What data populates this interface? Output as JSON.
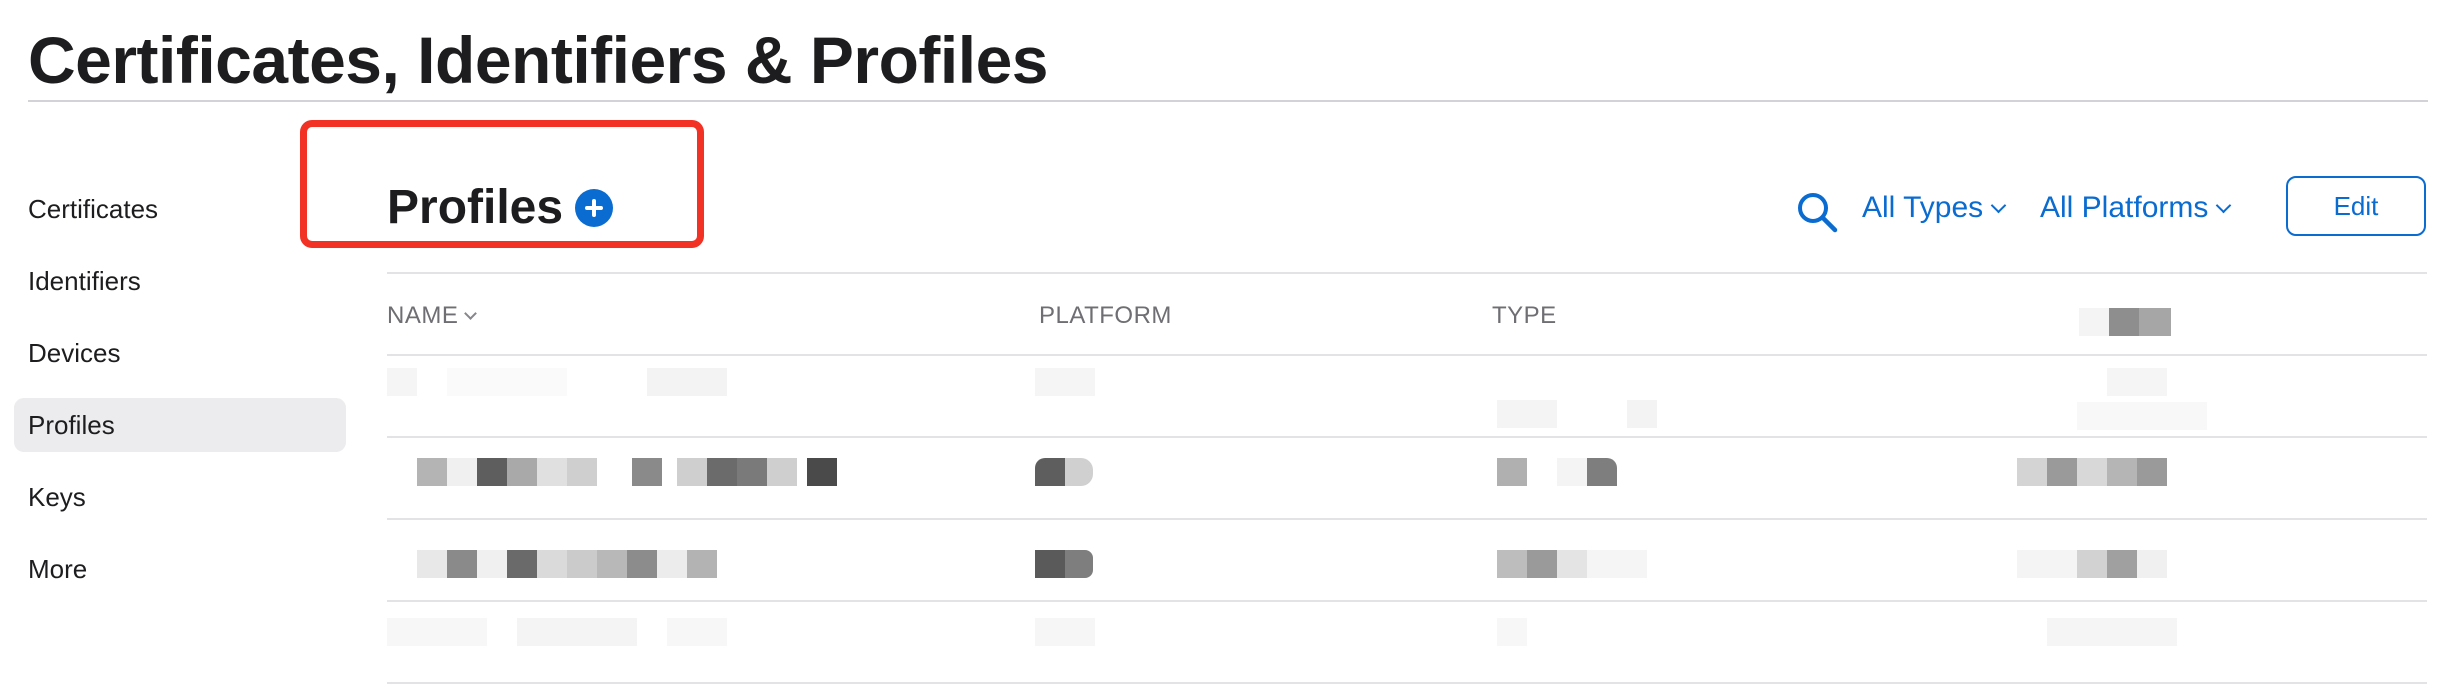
{
  "page_title": "Certificates, Identifiers & Profiles",
  "sidebar": {
    "items": [
      {
        "label": "Certificates"
      },
      {
        "label": "Identifiers"
      },
      {
        "label": "Devices"
      },
      {
        "label": "Profiles",
        "active": true
      },
      {
        "label": "Keys"
      },
      {
        "label": "More"
      }
    ]
  },
  "main": {
    "heading": "Profiles",
    "toolbar": {
      "filter_types": "All Types",
      "filter_platforms": "All Platforms",
      "edit_label": "Edit"
    },
    "table": {
      "columns": [
        "NAME",
        "PLATFORM",
        "TYPE"
      ]
    }
  },
  "colors": {
    "accent": "#0a6bd0",
    "highlight": "#f23224",
    "active_bg": "#ececee"
  },
  "icons": [
    "add-icon",
    "search-icon",
    "chevron-down-icon"
  ]
}
